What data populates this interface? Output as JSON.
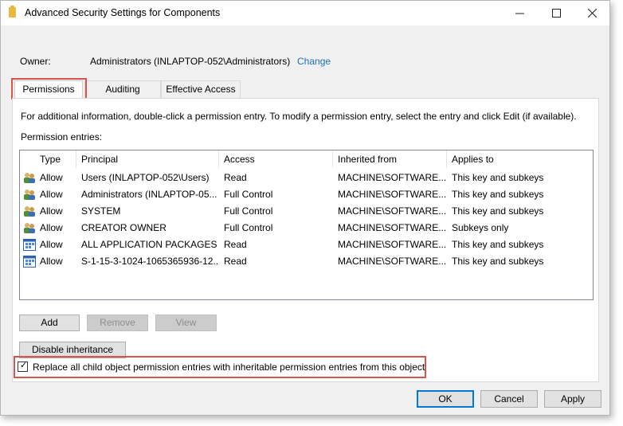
{
  "window": {
    "title": "Advanced Security Settings for Components",
    "icon": "folder-icon"
  },
  "owner": {
    "label": "Owner:",
    "value": "Administrators (INLAPTOP-052\\Administrators)",
    "change_link": "Change"
  },
  "tabs": [
    {
      "label": "Permissions",
      "active": true
    },
    {
      "label": "Auditing",
      "active": false
    },
    {
      "label": "Effective Access",
      "active": false
    }
  ],
  "permissions": {
    "info_text": "For additional information, double-click a permission entry. To modify a permission entry, select the entry and click Edit (if available).",
    "entries_label": "Permission entries:",
    "columns": [
      "Type",
      "Principal",
      "Access",
      "Inherited from",
      "Applies to"
    ],
    "rows": [
      {
        "icon": "users-icon",
        "type": "Allow",
        "principal": "Users (INLAPTOP-052\\Users)",
        "access": "Read",
        "inherited": "MACHINE\\SOFTWARE...",
        "applies": "This key and subkeys"
      },
      {
        "icon": "users-icon",
        "type": "Allow",
        "principal": "Administrators (INLAPTOP-05...",
        "access": "Full Control",
        "inherited": "MACHINE\\SOFTWARE...",
        "applies": "This key and subkeys"
      },
      {
        "icon": "users-icon",
        "type": "Allow",
        "principal": "SYSTEM",
        "access": "Full Control",
        "inherited": "MACHINE\\SOFTWARE...",
        "applies": "This key and subkeys"
      },
      {
        "icon": "users-icon",
        "type": "Allow",
        "principal": "CREATOR OWNER",
        "access": "Full Control",
        "inherited": "MACHINE\\SOFTWARE...",
        "applies": "Subkeys only"
      },
      {
        "icon": "app-packages-icon",
        "type": "Allow",
        "principal": "ALL APPLICATION PACKAGES",
        "access": "Read",
        "inherited": "MACHINE\\SOFTWARE...",
        "applies": "This key and subkeys"
      },
      {
        "icon": "app-packages-icon",
        "type": "Allow",
        "principal": "S-1-15-3-1024-1065365936-12...",
        "access": "Read",
        "inherited": "MACHINE\\SOFTWARE...",
        "applies": "This key and subkeys"
      }
    ],
    "buttons": {
      "add": "Add",
      "remove": "Remove",
      "view": "View"
    },
    "disable_inheritance": "Disable inheritance",
    "replace_checkbox": {
      "label": "Replace all child object permission entries with inheritable permission entries from this object",
      "checked": true
    }
  },
  "footer": {
    "ok": "OK",
    "cancel": "Cancel",
    "apply": "Apply"
  },
  "colors": {
    "highlight": "#d9534f",
    "link": "#1a6fb8",
    "focus": "#0078d7"
  }
}
